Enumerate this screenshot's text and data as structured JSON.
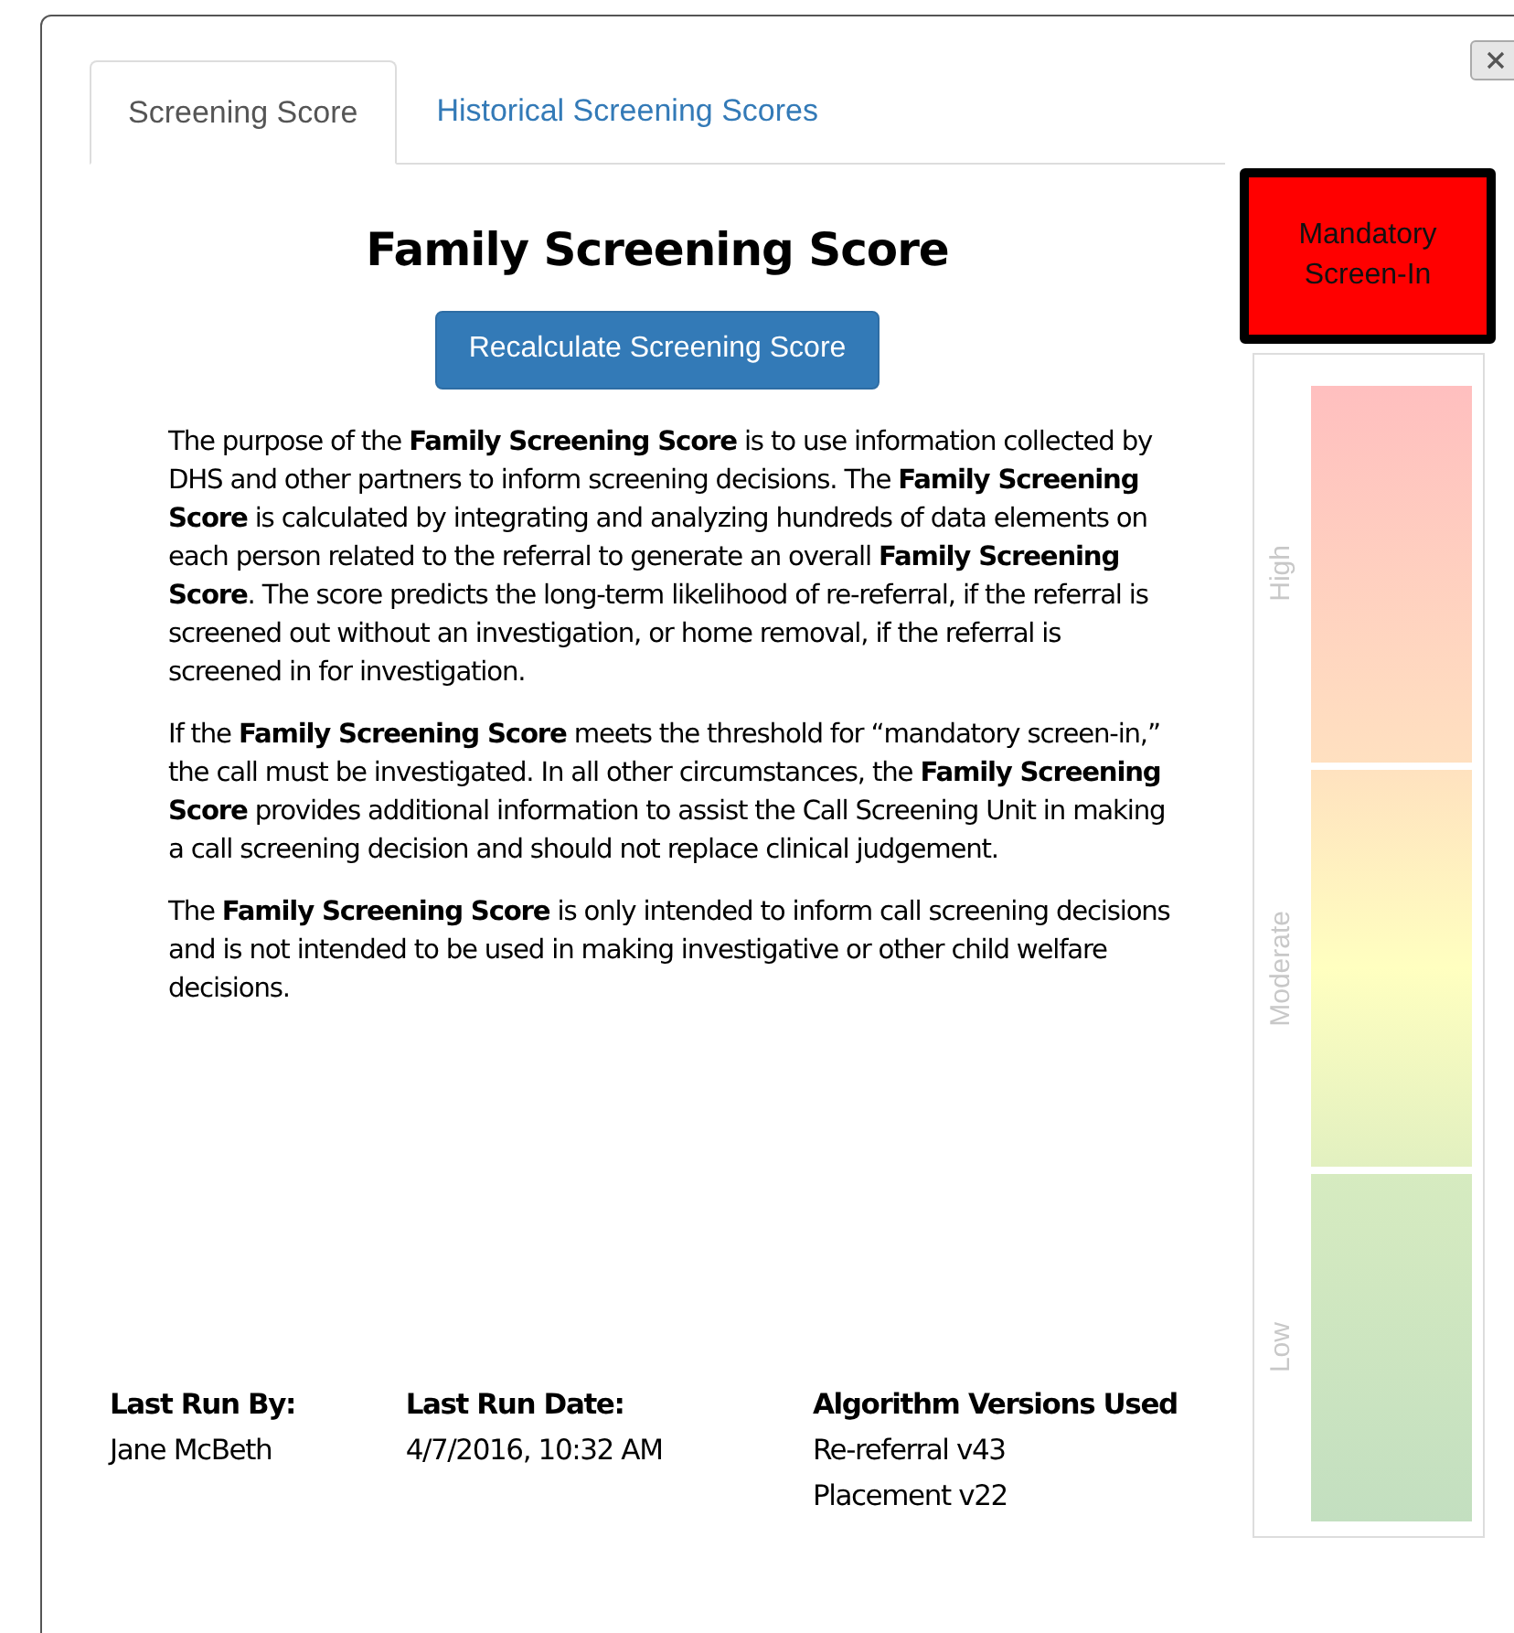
{
  "tabs": [
    {
      "label": "Screening Score",
      "selected": true
    },
    {
      "label": "Historical Screening Scores",
      "selected": false
    }
  ],
  "title": "Family Screening Score",
  "recalculate_button": "Recalculate Screening Score",
  "paragraphs": [
    "The purpose of the **Family Screening Score** is to use information collected by DHS and other partners to inform screening decisions. The **Family Screening Score** is calculated by integrating and analyzing hundreds of data elements on each person related to the referral to generate an overall **Family Screening Score**.  The score predicts the long-term likelihood of re-referral, if the referral is screened out without an investigation, or home removal, if the referral is screened in for investigation.",
    "If the **Family Screening Score** meets the threshold for “mandatory screen-in,” the call must be investigated. In all other circumstances, the **Family Screening Score** provides additional information to assist the Call Screening Unit in making a call screening decision and should not replace clinical judgement.",
    "The **Family Screening Score** is only intended to inform call screening decisions and is not intended to be used in making investigative or other child welfare decisions."
  ],
  "footer": [
    {
      "label": "Last Run By:",
      "values": [
        "Jane McBeth"
      ]
    },
    {
      "label": "Last Run Date:",
      "values": [
        "4/7/2016, 10:32 AM"
      ]
    },
    {
      "label": "Algorithm Versions Used",
      "values": [
        "Re-referral v43",
        "Placement v22"
      ]
    }
  ],
  "result": "Mandatory Screen-In",
  "gauge": [
    {
      "kind": "high",
      "label": "High"
    },
    {
      "kind": "moderate",
      "label": "Moderate"
    },
    {
      "kind": "low",
      "label": "Low"
    }
  ]
}
